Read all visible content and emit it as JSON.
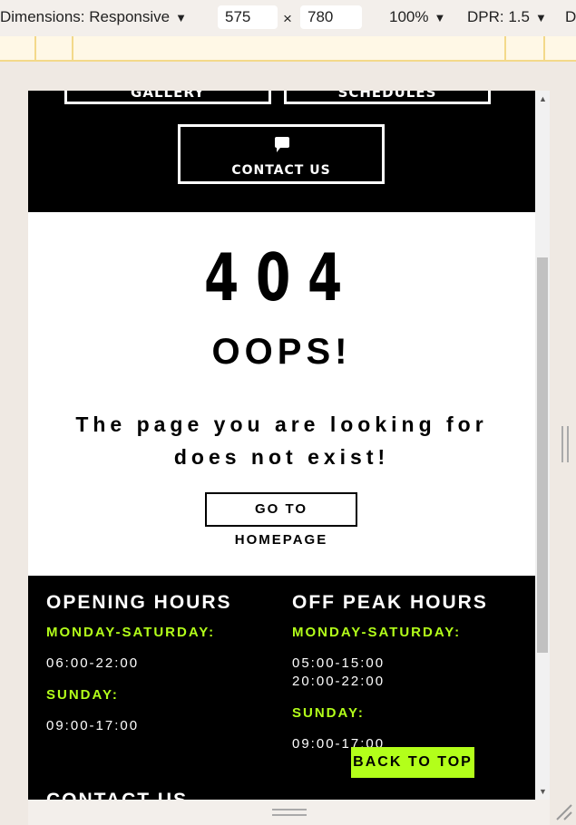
{
  "devtools": {
    "dimensions_label": "Dimensions: Responsive",
    "width": "575",
    "times": "×",
    "height": "780",
    "zoom": "100%",
    "dpr": "DPR: 1.5",
    "more": "D"
  },
  "nav": {
    "gallery": "GALLERY",
    "schedules": "SCHEDULES",
    "contact": "CONTACT US"
  },
  "error": {
    "code": "404",
    "title": "OOPS!",
    "message": "The page you are looking for does not exist!",
    "home_button": "GO TO HOMEPAGE"
  },
  "footer": {
    "opening": {
      "title": "OPENING HOURS",
      "weekday_label": "MONDAY-SATURDAY:",
      "weekday_time": "06:00-22:00",
      "sunday_label": "SUNDAY:",
      "sunday_time": "09:00-17:00"
    },
    "offpeak": {
      "title": "OFF PEAK HOURS",
      "weekday_label": "MONDAY-SATURDAY:",
      "weekday_time_1": "05:00-15:00",
      "weekday_time_2": "20:00-22:00",
      "sunday_label": "SUNDAY:",
      "sunday_time": "09:00-17:00"
    },
    "contact_title": "CONTACT US",
    "back_to_top": "BACK TO TOP"
  },
  "colors": {
    "accent": "#b3ff1a",
    "dark": "#000000"
  }
}
